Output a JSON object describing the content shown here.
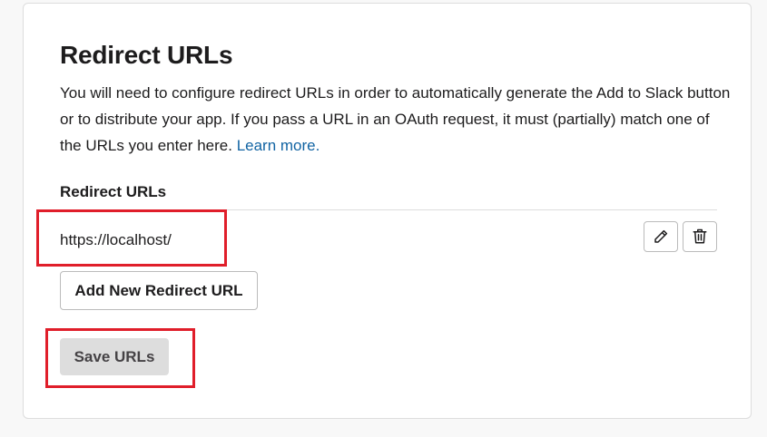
{
  "section": {
    "title": "Redirect URLs",
    "description": "You will need to configure redirect URLs in order to automatically generate the Add to Slack button or to distribute your app. If you pass a URL in an OAuth request, it must (partially) match one of the URLs you enter here.",
    "learn_more": "Learn more."
  },
  "redirect_urls": {
    "label": "Redirect URLs",
    "items": [
      {
        "url": "https://localhost/",
        "edit_icon": "pencil-icon",
        "delete_icon": "trash-icon"
      }
    ]
  },
  "actions": {
    "add_label": "Add New Redirect URL",
    "save_label": "Save URLs"
  },
  "annotations": {
    "highlight_color": "#e01e2a"
  },
  "colors": {
    "link": "#1264a3",
    "text": "#1d1c1d",
    "save_bg": "#dddddd"
  }
}
